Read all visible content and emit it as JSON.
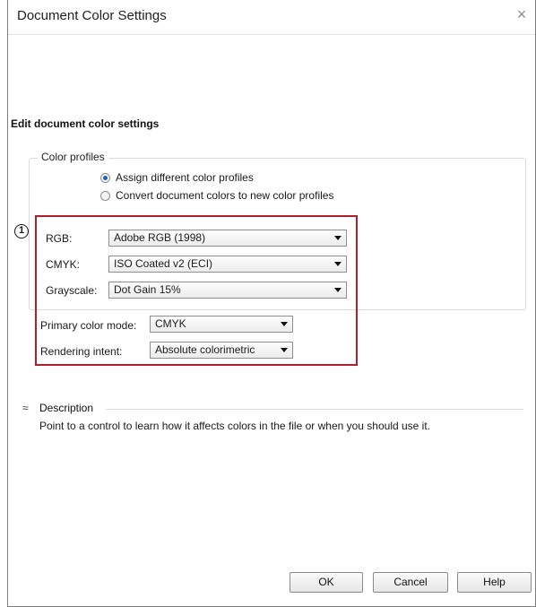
{
  "window": {
    "title": "Document Color Settings",
    "close_glyph": "×",
    "header": "Edit document color settings"
  },
  "color_profiles": {
    "legend": "Color profiles",
    "options": [
      {
        "label": "Assign different color profiles",
        "checked": true
      },
      {
        "label": "Convert document colors to new color profiles",
        "checked": false
      }
    ],
    "rgb": {
      "label": "RGB:",
      "value": "Adobe RGB (1998)"
    },
    "cmyk": {
      "label": "CMYK:",
      "value": "ISO Coated v2 (ECI)"
    },
    "grayscale": {
      "label": "Grayscale:",
      "value": "Dot Gain 15%"
    }
  },
  "primary_color_mode": {
    "label": "Primary color mode:",
    "value": "CMYK"
  },
  "rendering_intent": {
    "label": "Rendering intent:",
    "value": "Absolute colorimetric"
  },
  "callout": "1",
  "description": {
    "toggle_glyph": "≈",
    "title": "Description",
    "text": "Point to a control to learn how it affects colors in the file or when you should use it."
  },
  "buttons": {
    "ok": "OK",
    "cancel": "Cancel",
    "help": "Help"
  },
  "colors": {
    "highlight_box": "#b0202a",
    "radio_dot": "#1f5fbf"
  }
}
